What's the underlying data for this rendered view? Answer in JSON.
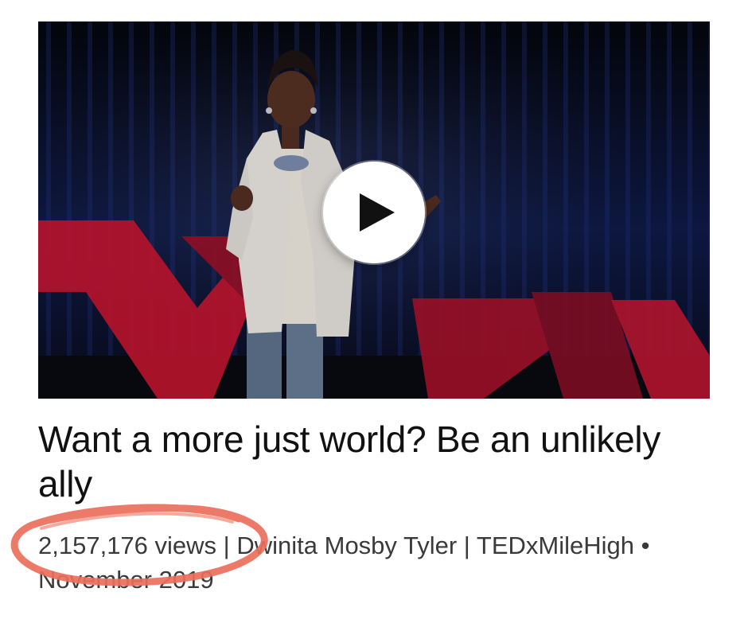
{
  "talk": {
    "title": "Want a more just world? Be an unlikely ally",
    "views": "2,157,176 views",
    "speaker": "Dwinita Mosby Tyler",
    "event": "TEDxMileHigh",
    "date": "November 2019",
    "separator": "|",
    "bullet": "•"
  },
  "thumbnail": {
    "play_icon": "play-icon",
    "colors": {
      "backdrop": "#05070e",
      "curtain": "#1a2a6a",
      "ted_red": "#c4142a",
      "jacket": "#d8d4d0",
      "jeans": "#5d6f86",
      "play_bg": "#ffffff",
      "play_fg": "#111111"
    }
  },
  "annotation": {
    "color": "#ec6f5c",
    "shape": "hand-drawn-circle"
  }
}
